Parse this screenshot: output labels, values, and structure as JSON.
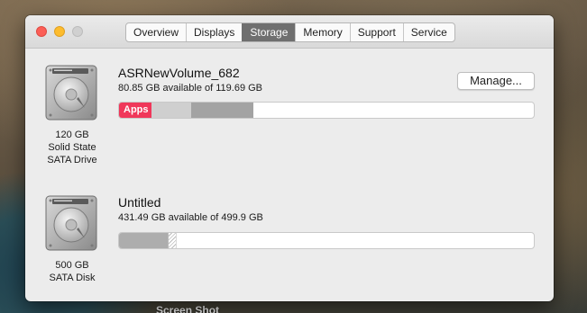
{
  "desktop": {
    "label": "Screen Shot"
  },
  "window": {
    "tabs": [
      {
        "label": "Overview"
      },
      {
        "label": "Displays"
      },
      {
        "label": "Storage",
        "active": true
      },
      {
        "label": "Memory"
      },
      {
        "label": "Support"
      },
      {
        "label": "Service"
      }
    ]
  },
  "disks": [
    {
      "icon": "hard-drive-icon",
      "caption": [
        "120 GB",
        "Solid State",
        "SATA Drive"
      ],
      "name": "ASRNewVolume_682",
      "available": "80.85 GB available of 119.69 GB",
      "manage_label": "Manage...",
      "segments": [
        {
          "label": "Apps",
          "color": "#f0375a"
        },
        {
          "label": "",
          "color": "#cfcfcf"
        },
        {
          "label": "",
          "color": "#a3a3a3"
        }
      ]
    },
    {
      "icon": "hard-drive-icon",
      "caption": [
        "500 GB",
        "SATA Disk"
      ],
      "name": "Untitled",
      "available": "431.49 GB available of 499.9 GB",
      "segments": [
        {
          "label": "",
          "color": "#adadad"
        },
        {
          "label": "",
          "color": "purgeable-hatch"
        }
      ]
    }
  ],
  "colors": {
    "apps": "#f0375a",
    "active_tab": "#6f6f6f",
    "close": "#fc5f57",
    "minimize": "#fdbc2e",
    "zoom_disabled": "#d0d0d0"
  }
}
